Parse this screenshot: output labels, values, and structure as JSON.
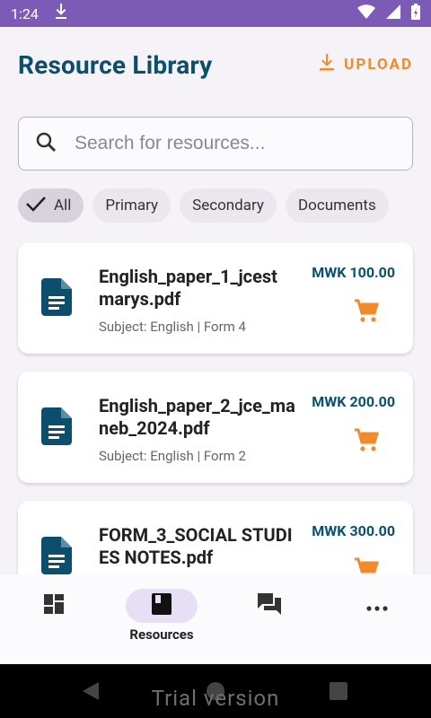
{
  "status_bar": {
    "time": "1:24"
  },
  "header": {
    "title": "Resource Library",
    "upload_label": "UPLOAD"
  },
  "search": {
    "placeholder": "Search for resources..."
  },
  "filters": [
    {
      "label": "All",
      "selected": true
    },
    {
      "label": "Primary",
      "selected": false
    },
    {
      "label": "Secondary",
      "selected": false
    },
    {
      "label": "Documents",
      "selected": false
    }
  ],
  "resources": [
    {
      "name": "English_paper_1_jcest marys.pdf",
      "meta": "Subject: English | Form 4",
      "price": "MWK 100.00"
    },
    {
      "name": "English_paper_2_jce_maneb_2024.pdf",
      "meta": "Subject: English | Form 2",
      "price": "MWK 200.00"
    },
    {
      "name": "FORM_3_SOCIAL STUDIES NOTES.pdf",
      "meta": "",
      "price": "MWK 300.00"
    }
  ],
  "bottom_nav": {
    "items": [
      {
        "icon": "dashboard-icon"
      },
      {
        "icon": "book-icon",
        "label": "Resources",
        "active": true
      },
      {
        "icon": "forum-icon"
      },
      {
        "icon": "more-horizontal-icon"
      }
    ]
  },
  "watermark": "Trial version",
  "colors": {
    "accent": "#0b4f6c",
    "upload": "#f08a2a",
    "status_bar": "#7b5bb5"
  }
}
